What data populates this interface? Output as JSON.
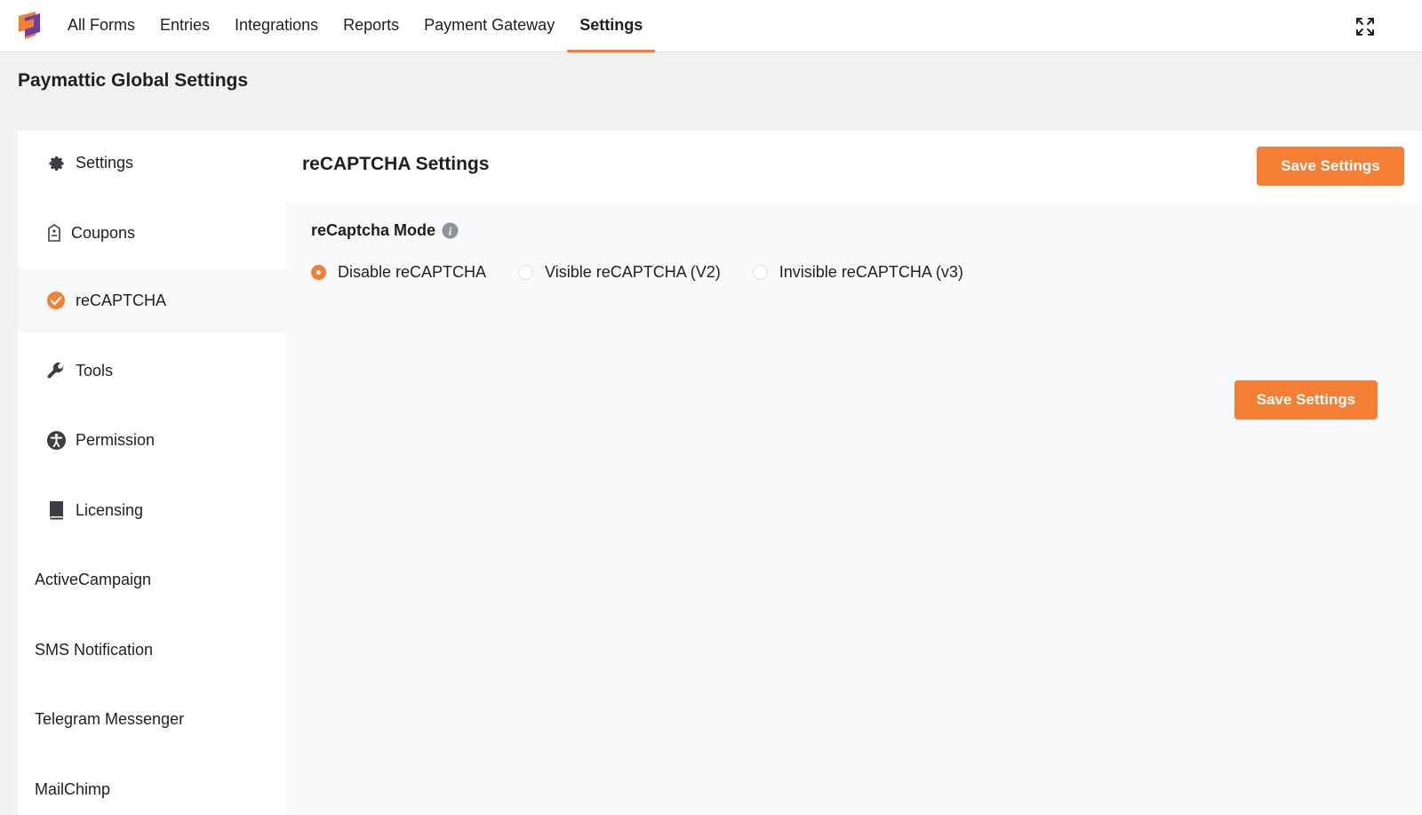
{
  "nav": {
    "items": [
      {
        "label": "All Forms",
        "active": false
      },
      {
        "label": "Entries",
        "active": false
      },
      {
        "label": "Integrations",
        "active": false
      },
      {
        "label": "Reports",
        "active": false
      },
      {
        "label": "Payment Gateway",
        "active": false
      },
      {
        "label": "Settings",
        "active": true
      }
    ]
  },
  "page": {
    "title": "Paymattic Global Settings"
  },
  "sidebar": {
    "items": [
      {
        "label": "Settings",
        "icon": "gear-icon"
      },
      {
        "label": "Coupons",
        "icon": "coupon-icon"
      },
      {
        "label": "reCAPTCHA",
        "icon": "check-circle-icon",
        "active": true
      },
      {
        "label": "Tools",
        "icon": "wrench-icon"
      },
      {
        "label": "Permission",
        "icon": "accessibility-icon"
      },
      {
        "label": "Licensing",
        "icon": "book-icon"
      },
      {
        "label": "ActiveCampaign"
      },
      {
        "label": "SMS Notification"
      },
      {
        "label": "Telegram Messenger"
      },
      {
        "label": "MailChimp"
      }
    ]
  },
  "content": {
    "title": "reCAPTCHA Settings",
    "save_label_top": "Save Settings",
    "save_label_bottom": "Save Settings",
    "field_label": "reCaptcha Mode",
    "radios": [
      {
        "label": "Disable reCAPTCHA",
        "checked": true
      },
      {
        "label": "Visible reCAPTCHA (V2)",
        "checked": false
      },
      {
        "label": "Invisible reCAPTCHA (v3)",
        "checked": false
      }
    ]
  },
  "colors": {
    "accent": "#f47f34",
    "brand_purple": "#6b3fa0"
  }
}
